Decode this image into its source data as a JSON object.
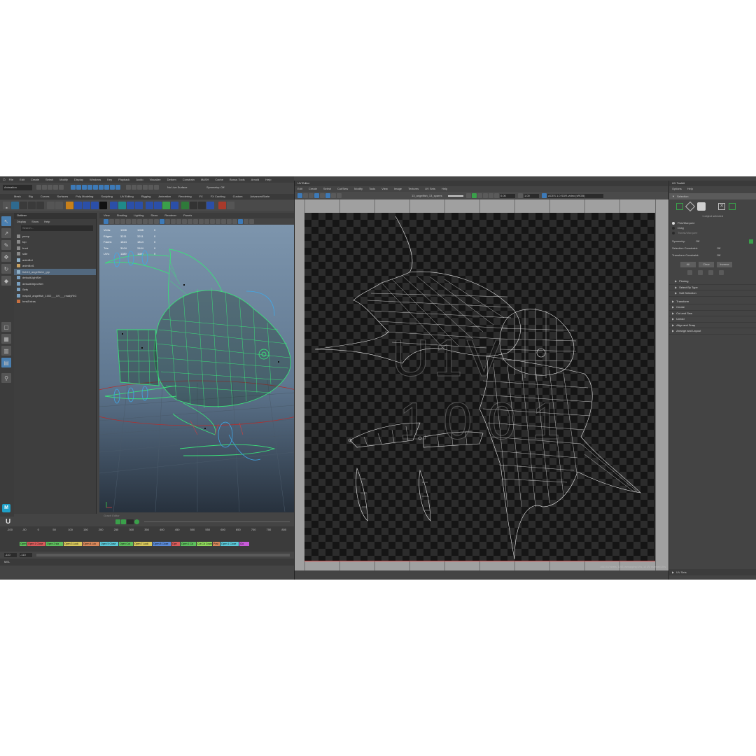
{
  "maya": {
    "main_menu": [
      "File",
      "Edit",
      "Create",
      "Select",
      "Modify",
      "Display",
      "Windows",
      "Key",
      "Playback",
      "Audio",
      "Visualize",
      "Deform",
      "Constrain",
      "MASH",
      "Cache",
      "Bonus Tools",
      "Arnold",
      "Help"
    ],
    "mode_select": "Animation",
    "live_surface": "No Live Surface",
    "symmetry": "Symmetry: Off",
    "shelf_tabs": [
      "Curves",
      "Surfaces",
      "Poly Modeling",
      "Sculpting",
      "UV Editing",
      "Rigging",
      "Animation",
      "Rendering",
      "FX",
      "FX Caching",
      "Custom",
      "AdvancedSkele"
    ],
    "shelf_tabs_left": [
      "Mesh",
      "Rig"
    ],
    "outliner": {
      "title": "Outliner",
      "menu": [
        "Display",
        "Show",
        "Help"
      ],
      "search_placeholder": "Search...",
      "items": [
        {
          "name": "persp",
          "color": "#8a8a8a"
        },
        {
          "name": "top",
          "color": "#8a8a8a"
        },
        {
          "name": "front",
          "color": "#8a8a8a"
        },
        {
          "name": "side",
          "color": "#8a8a8a"
        },
        {
          "name": "animBot",
          "color": "#8fb0c8"
        },
        {
          "name": "animBot1",
          "color": "#c8a060"
        },
        {
          "name": "fish13_angelfish1_grp",
          "color": "#8fb0c8"
        },
        {
          "name": "defaultLightSet",
          "color": "#7aa0c0"
        },
        {
          "name": "defaultObjectSet",
          "color": "#7aa0c0"
        },
        {
          "name": "Sets",
          "color": "#7aa0c0"
        },
        {
          "name": "maya3_angelfish_1002___UV___readyRIG",
          "color": "#7aa0c0"
        },
        {
          "name": "hmsExtras",
          "color": "#c87040"
        }
      ]
    },
    "viewport": {
      "menu": [
        "View",
        "Shading",
        "Lighting",
        "Show",
        "Renderer",
        "Panels"
      ],
      "stats": [
        {
          "label": "Verts:",
          "a": "1008",
          "b": "1008",
          "c": "0"
        },
        {
          "label": "Edges:",
          "a": "3211",
          "b": "3211",
          "c": "0"
        },
        {
          "label": "Faces:",
          "a": "1814",
          "b": "1814",
          "c": "0"
        },
        {
          "label": "Tris:",
          "a": "3104",
          "b": "3104",
          "c": "0"
        },
        {
          "label": "UVs:",
          "a": "1189",
          "b": "1189",
          "c": "0"
        }
      ],
      "graph_label": "Graph Editor"
    },
    "timeline": {
      "ticks": [
        "-100",
        "-50",
        "0",
        "50",
        "100",
        "150",
        "200",
        "250",
        "300",
        "350",
        "400",
        "450",
        "500",
        "550",
        "600",
        "650",
        "700",
        "750",
        "800"
      ],
      "start_field": "-110",
      "end_field": "-110",
      "mel_label": "MEL",
      "key_labels": [
        {
          "text": "Open 1",
          "color": "#5dbf5d"
        },
        {
          "text": "Open 1 Close",
          "color": "#d95b5b"
        },
        {
          "text": "Open 2 sta",
          "color": "#5dbf5d"
        },
        {
          "text": "Open 3 Look",
          "color": "#d9c85b"
        },
        {
          "text": "Open 4 Lok",
          "color": "#d9885b"
        },
        {
          "text": "Open 5 Close",
          "color": "#5bc9d9"
        },
        {
          "text": "Open Cut",
          "color": "#5dbf5d"
        },
        {
          "text": "Open 7 Look",
          "color": "#d9c85b"
        },
        {
          "text": "Open 8 Close",
          "color": "#5b8bd9"
        },
        {
          "text": "Ope",
          "color": "#d95b5b"
        },
        {
          "text": "Open 1 Cd",
          "color": "#5dbf5d"
        },
        {
          "text": "Cut Cd Cosed",
          "color": "#8fd95b"
        },
        {
          "text": "Post",
          "color": "#d9885b"
        },
        {
          "text": "Open 1 Close",
          "color": "#5bc9d9"
        },
        {
          "text": "Clo",
          "color": "#c85bd9"
        }
      ]
    }
  },
  "uv_editor": {
    "title": "UV Editor",
    "menu": [
      "Edit",
      "Create",
      "Select",
      "Cut/Sew",
      "Modify",
      "Tools",
      "View",
      "Image",
      "Textures",
      "UV Sets",
      "Help"
    ],
    "texture_field": "13_angelfish_13_spares",
    "value_a": "0.00",
    "value_b": "1.00",
    "colorspace": "ACES 1.0 SDR-video (sRGB)",
    "tile_label_top": "U1V",
    "tile_label_bottom": "1001",
    "status": "1063 UV shells, 1063 overlapping UVs, 10 UV reversed UVs"
  },
  "uv_toolkit": {
    "title": "UV Toolkit",
    "menu": [
      "Options",
      "Help"
    ],
    "selection_header": "Selection",
    "selected_count": "1 object selected",
    "radio_options": [
      "Pick/Marquee",
      "Drag",
      "Tweak/Marquee"
    ],
    "symmetry_label": "Symmetry:",
    "symmetry_value": "Off",
    "constraint_label": "Selection Constraint:",
    "constraint_value": "Off",
    "transform_label": "Transform Constraint:",
    "transform_value": "Off",
    "buttons": [
      "All",
      "Clear",
      "Inverse"
    ],
    "sub_sections": [
      "Pinning",
      "Select By Type",
      "Soft Selection"
    ],
    "sections": [
      "Transform",
      "Create",
      "Cut and Sew",
      "Unfold",
      "Align and Snap",
      "Arrange and Layout"
    ],
    "footer": "UV Sets"
  }
}
